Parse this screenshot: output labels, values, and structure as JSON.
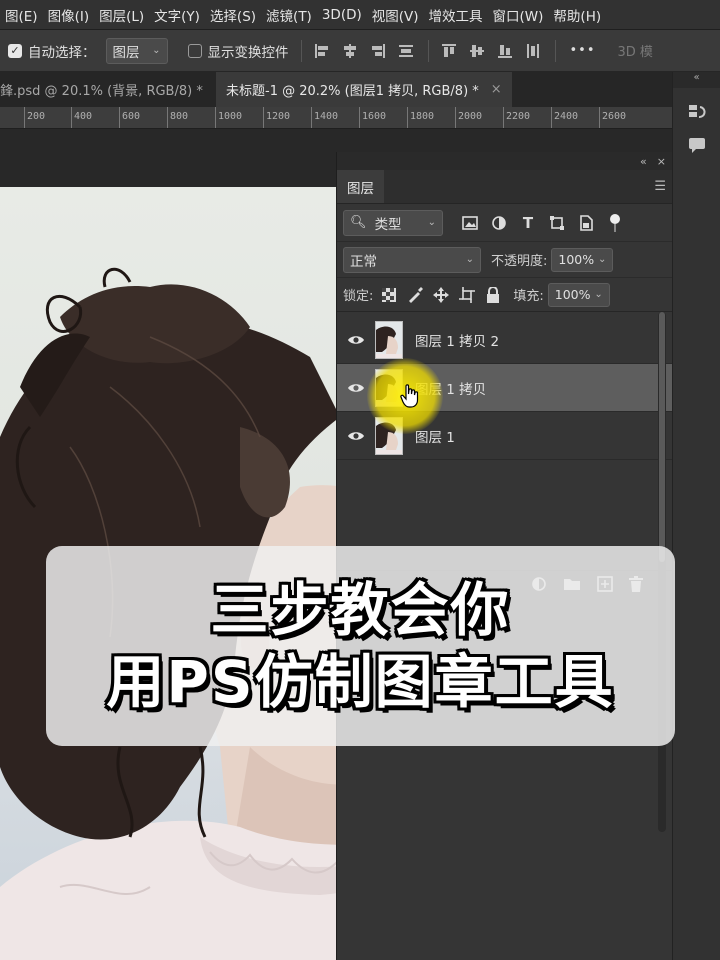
{
  "menu": [
    "图(E)",
    "图像(I)",
    "图层(L)",
    "文字(Y)",
    "选择(S)",
    "滤镜(T)",
    "3D(D)",
    "视图(V)",
    "增效工具",
    "窗口(W)",
    "帮助(H)"
  ],
  "options": {
    "auto_select_label": "自动选择：",
    "auto_select_target": "图层",
    "show_transform_label": "显示变换控件",
    "mode_3d": "3D 模",
    "more": "•••"
  },
  "tabs": [
    {
      "label": "鋒.psd @ 20.1% (背景, RGB/8) *",
      "close": "×"
    },
    {
      "label": "未标题-1 @ 20.2% (图层1 拷贝, RGB/8) *",
      "close": "×"
    }
  ],
  "ruler": [
    "200",
    "400",
    "600",
    "800",
    "1000",
    "1200",
    "1400",
    "1600",
    "1800",
    "2000",
    "2200",
    "2400",
    "2600"
  ],
  "dock": {
    "collapse": "«"
  },
  "layers_panel": {
    "collapse": "«",
    "close": "×",
    "tab": "图层",
    "filter_kind": "类型",
    "blend_mode": "正常",
    "opacity_label": "不透明度:",
    "opacity_value": "100%",
    "lock_label": "锁定:",
    "fill_label": "填充:",
    "fill_value": "100%",
    "layers": [
      {
        "name": "图层 1 拷贝 2",
        "selected": false
      },
      {
        "name": "图层 1 拷贝",
        "selected": true
      },
      {
        "name": "图层 1",
        "selected": false
      }
    ]
  },
  "overlay": {
    "line1": "三步教会你",
    "line2": "用PS仿制图章工具"
  },
  "colors": {
    "app_bg": "#2b2b2b",
    "panel": "#353535",
    "selected_layer": "#5e5e5e",
    "cursor_highlight": "#f2e000"
  }
}
